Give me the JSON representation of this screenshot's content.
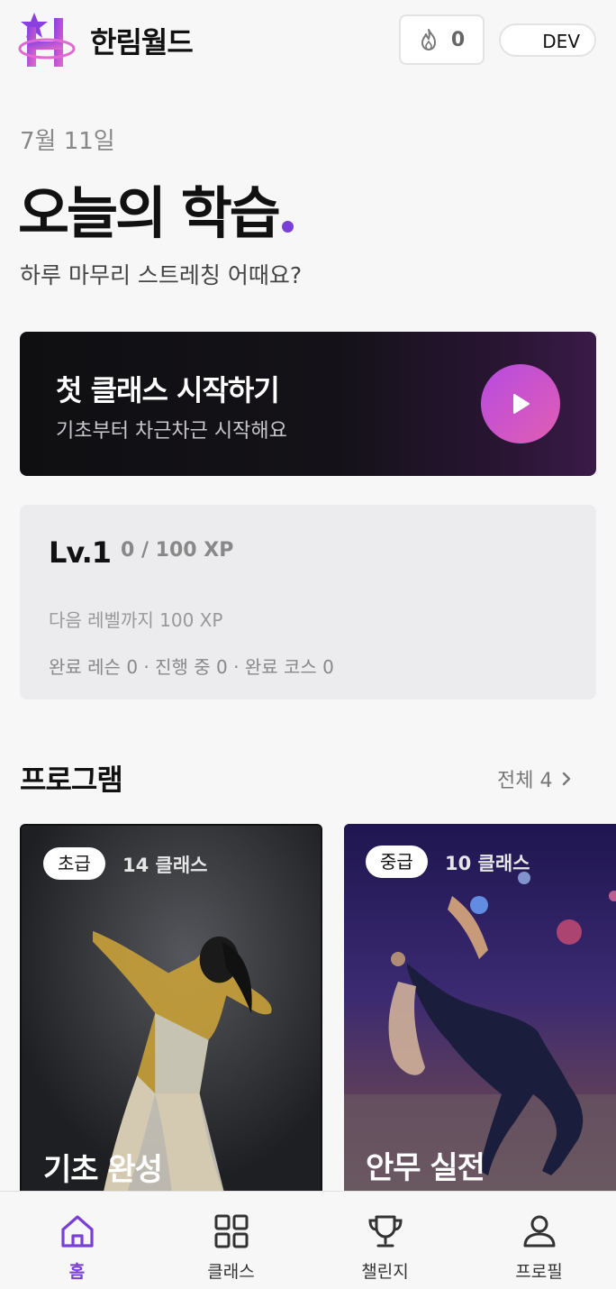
{
  "header": {
    "app_title": "한림월드",
    "streak_count": "0",
    "env_badge": "DEV"
  },
  "greeting": {
    "date": "7월 11일",
    "headline": "오늘의 학습",
    "subtitle": "하루 마무리 스트레칭 어때요?"
  },
  "start_card": {
    "title": "첫 클래스 시작하기",
    "subtitle": "기초부터 차근차근 시작해요"
  },
  "level": {
    "label": "Lv.1",
    "xp": "0 / 100 XP",
    "next": "다음 레벨까지 100 XP",
    "stats": "완료 레슨 0 · 진행 중 0 · 완료 코스 0"
  },
  "programs": {
    "title": "프로그램",
    "see_all": "전체 4",
    "cards": [
      {
        "level": "초급",
        "count": "14 클래스",
        "title": "기초 완성"
      },
      {
        "level": "중급",
        "count": "10 클래스",
        "title": "안무 실전"
      }
    ]
  },
  "nav": {
    "items": [
      {
        "label": "홈",
        "icon": "home-icon",
        "active": true
      },
      {
        "label": "클래스",
        "icon": "grid-icon",
        "active": false
      },
      {
        "label": "챌린지",
        "icon": "trophy-icon",
        "active": false
      },
      {
        "label": "프로필",
        "icon": "person-icon",
        "active": false
      }
    ]
  },
  "colors": {
    "accent": "#7a3fd6",
    "play_gradient_start": "#b64be0",
    "play_gradient_end": "#e25db3",
    "logo_pink": "#e06ad0"
  }
}
